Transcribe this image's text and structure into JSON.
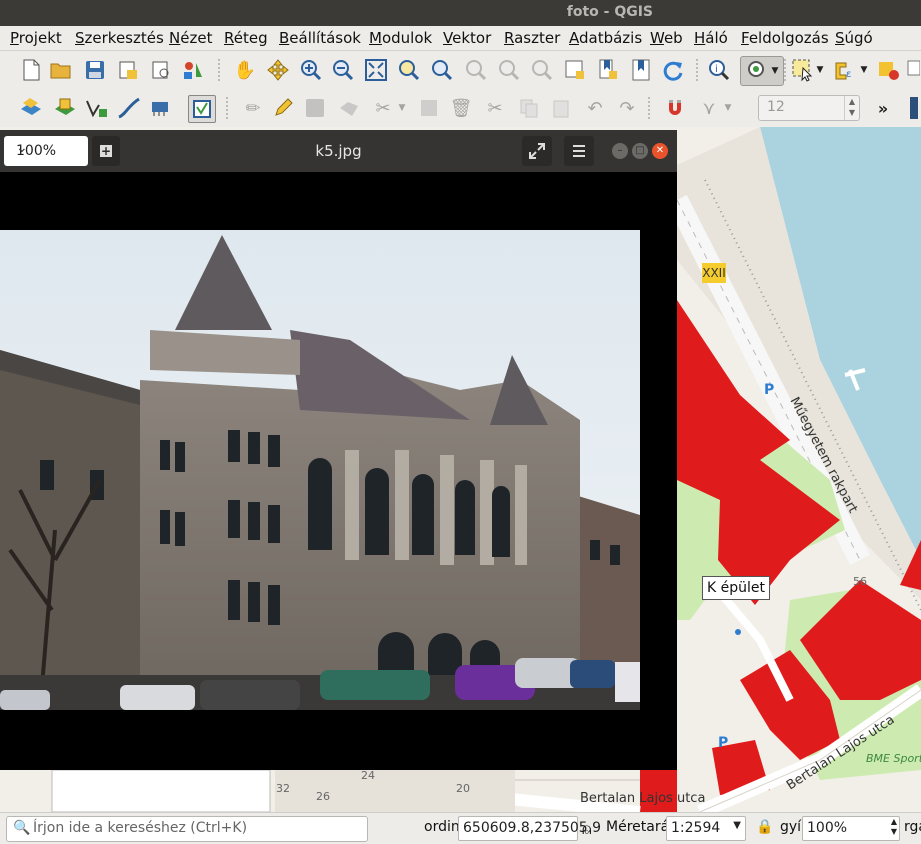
{
  "window": {
    "title": "foto - QGIS"
  },
  "menu": [
    "Projekt",
    "Szerkesztés",
    "Nézet",
    "Réteg",
    "Beállítások",
    "Modulok",
    "Vektor",
    "Raszter",
    "Adatbázis",
    "Web",
    "Háló",
    "Feldolgozás",
    "Súgó"
  ],
  "toolbar2": {
    "spin_value": "12"
  },
  "popup": {
    "zoom": "100%",
    "filename": "k5.jpg"
  },
  "map": {
    "label": "K épület",
    "badge": "XXII",
    "street1": "Műegyetem rakpart",
    "street2": "Bertalan Lajos utca",
    "street3": "Bertalan Lajos utca",
    "poi": "BME Sport",
    "numbers": [
      "56",
      "32",
      "24",
      "26",
      "20"
    ],
    "colors": {
      "building": "#e01b1b",
      "water": "#aad3df",
      "park": "#cdebb0"
    }
  },
  "status": {
    "search_placeholder": "Írjon ide a kereséshez (Ctrl+K)",
    "coord_label": "ordiná",
    "coord_value": "650609.8,237505.9",
    "scale_label": "Méretarán",
    "scale_value": "1:2594",
    "magnifier_label": "gyíl",
    "magnifier_value": "100%",
    "rotation_label": "rgat"
  }
}
